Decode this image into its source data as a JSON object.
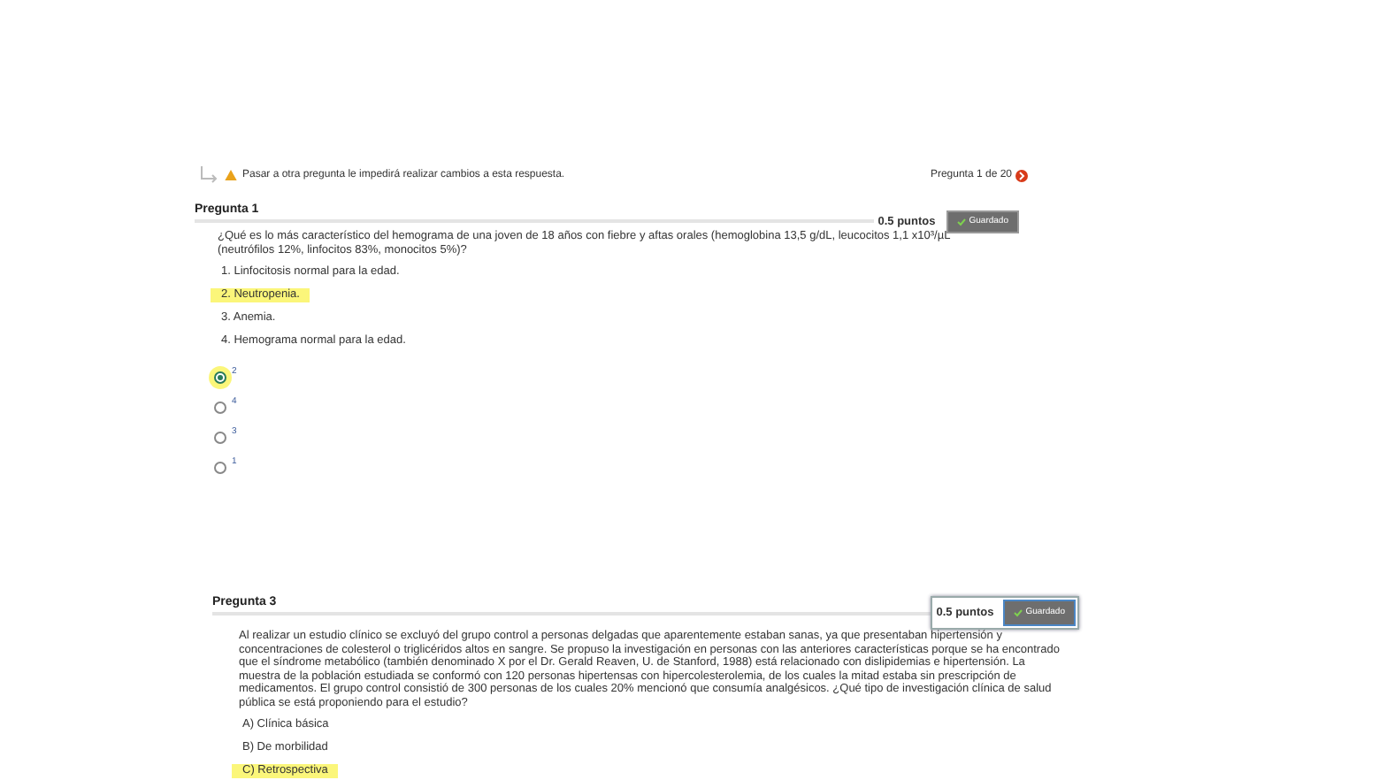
{
  "notice": {
    "text": "Pasar a otra pregunta le impedirá realizar cambios a esta respuesta.",
    "progress": "Pregunta 1 de 20"
  },
  "questions": [
    {
      "title": "Pregunta 1",
      "points": "0.5 puntos",
      "saved_label": "Guardado",
      "focused": false,
      "text": "¿Qué es lo más característico del hemograma de una joven de 18 años con fiebre y aftas orales (hemoglobina 13,5 g/dL, leucocitos 1,1 x10³/µL (neutrófilos 12%, linfocitos 83%, monocitos 5%)?",
      "statements": [
        {
          "text": "1. Linfocitosis normal para la edad.",
          "highlighted": false
        },
        {
          "text": "2. Neutropenia.",
          "highlighted": true
        },
        {
          "text": "3. Anemia.",
          "highlighted": false
        },
        {
          "text": "4. Hemograma normal para la edad.",
          "highlighted": false
        }
      ],
      "choices": [
        {
          "label": "2",
          "selected": true
        },
        {
          "label": "4",
          "selected": false
        },
        {
          "label": "3",
          "selected": false
        },
        {
          "label": "1",
          "selected": false
        }
      ]
    },
    {
      "title": "Pregunta 3",
      "points": "0.5 puntos",
      "saved_label": "Guardado",
      "focused": true,
      "text": "Al realizar un estudio clínico se excluyó del grupo control a personas delgadas que aparentemente estaban sanas, ya que presentaban hipertensión y concentraciones de colesterol o triglicéridos altos en sangre. Se propuso la investigación en personas con las anteriores características porque se ha encontrado que el síndrome metabólico (también denominado X por el Dr. Gerald Reaven, U. de Stanford, 1988) está relacionado con dislipidemias e hipertensión. La muestra de la población estudiada se conformó con 120 personas hipertensas con hipercolesterolemia, de los cuales la mitad estaba sin prescripción de medicamentos. El grupo control consistió de 300 personas de los cuales 20% mencionó que consumía analgésicos. ¿Qué tipo de investigación clínica de salud pública se está proponiendo para el estudio?",
      "statements": [
        {
          "text": "A) Clínica básica",
          "highlighted": false
        },
        {
          "text": "B) De morbilidad",
          "highlighted": false
        },
        {
          "text": "C) Retrospectiva",
          "highlighted": true
        }
      ]
    }
  ]
}
